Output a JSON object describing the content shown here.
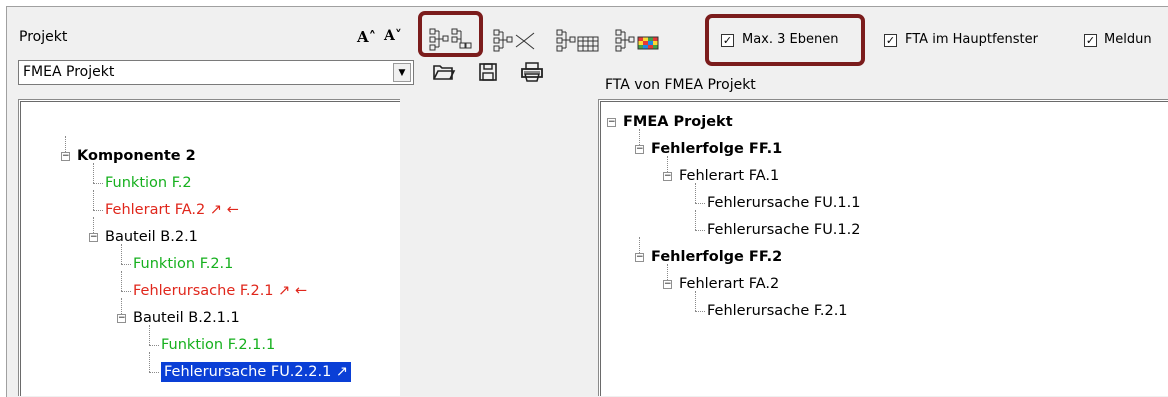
{
  "left": {
    "project_label": "Projekt",
    "combo_value": "FMEA Projekt",
    "combo_arrow": "▼",
    "tree": [
      {
        "text": "Komponente 2",
        "style": "bold",
        "level": 0,
        "expander": "−"
      },
      {
        "text": "Funktion F.2",
        "style": "green",
        "level": 1
      },
      {
        "text": "Fehlerart FA.2 ↗ ←",
        "style": "red",
        "level": 1
      },
      {
        "text": "Bauteil B.2.1",
        "style": "normal",
        "level": 1,
        "expander": "−"
      },
      {
        "text": "Funktion F.2.1",
        "style": "green",
        "level": 2
      },
      {
        "text": "Fehlerursache F.2.1 ↗ ←",
        "style": "red",
        "level": 2
      },
      {
        "text": "Bauteil B.2.1.1",
        "style": "normal",
        "level": 2,
        "expander": "−"
      },
      {
        "text": "Funktion F.2.1.1",
        "style": "green",
        "level": 3
      },
      {
        "text": "Fehlerursache FU.2.2.1 ↗",
        "style": "selected",
        "level": 3
      }
    ]
  },
  "toolbar": {
    "font_bigger": "A˄",
    "font_smaller": "A˅",
    "open_icon": "📂",
    "save_icon": "💾",
    "print_icon": "🖨"
  },
  "options": {
    "max_levels_label": "Max. 3 Ebenen",
    "fta_main_label": "FTA im Hauptfenster",
    "messages_label": "Meldun",
    "check_mark": "✓"
  },
  "right": {
    "title": "FTA von FMEA Projekt",
    "tree": [
      {
        "text": "FMEA Projekt",
        "style": "bold",
        "level": 0,
        "expander": "−"
      },
      {
        "text": "Fehlerfolge FF.1",
        "style": "bold",
        "level": 1,
        "expander": "−"
      },
      {
        "text": "Fehlerart FA.1",
        "style": "normal",
        "level": 2,
        "expander": "−"
      },
      {
        "text": "Fehlerursache FU.1.1",
        "style": "normal",
        "level": 3
      },
      {
        "text": "Fehlerursache FU.1.2",
        "style": "normal",
        "level": 3
      },
      {
        "text": "Fehlerfolge FF.2",
        "style": "bold",
        "level": 1,
        "expander": "−"
      },
      {
        "text": "Fehlerart FA.2",
        "style": "normal",
        "level": 2,
        "expander": "−"
      },
      {
        "text": "Fehlerursache F.2.1",
        "style": "normal",
        "level": 3
      }
    ]
  },
  "colors": {
    "highlight_border": "#7b1c1c",
    "function_green": "#16b01e",
    "failure_red": "#e0271c",
    "selection_blue": "#0a3fd6"
  }
}
